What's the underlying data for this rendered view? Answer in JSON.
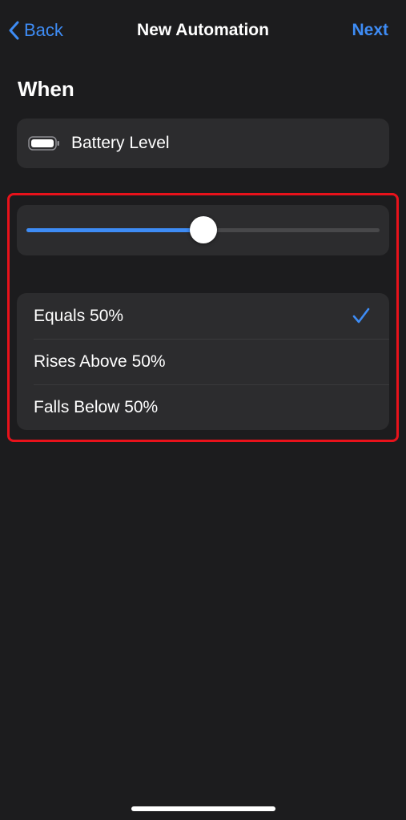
{
  "nav": {
    "back_label": "Back",
    "title": "New Automation",
    "next_label": "Next"
  },
  "section": {
    "heading": "When"
  },
  "trigger": {
    "icon": "battery-icon",
    "label": "Battery Level"
  },
  "slider": {
    "value_percent": 50
  },
  "options": [
    {
      "label": "Equals 50%",
      "selected": true
    },
    {
      "label": "Rises Above 50%",
      "selected": false
    },
    {
      "label": "Falls Below 50%",
      "selected": false
    }
  ],
  "colors": {
    "accent": "#3e8cf5",
    "background": "#1c1c1e",
    "card": "#2c2c2e",
    "highlight": "#e8121b"
  }
}
